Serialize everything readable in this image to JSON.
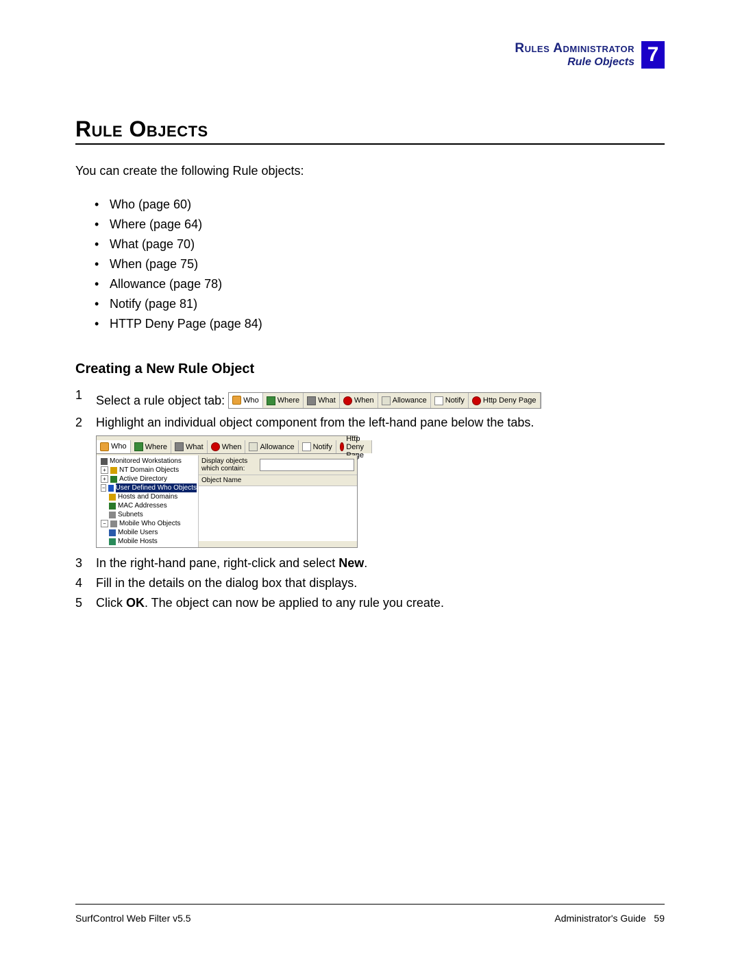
{
  "header": {
    "chapter": "Rules Administrator",
    "section": "Rule Objects",
    "num": "7"
  },
  "title": "Rule Objects",
  "intro": "You can create the following Rule objects:",
  "bullets": [
    "Who (page 60)",
    "Where (page 64)",
    "What (page 70)",
    "When (page 75)",
    "Allowance (page 78)",
    "Notify (page 81)",
    "HTTP Deny Page (page 84)"
  ],
  "subhead": "Creating a New Rule Object",
  "steps": {
    "s1": "Select a rule object tab:",
    "s2": "Highlight an individual object component from the left-hand pane below the tabs.",
    "s3a": "In the right-hand pane, right-click and select ",
    "s3b": "New",
    "s3c": ".",
    "s4": "Fill in the details on the dialog box that displays.",
    "s5a": "Click ",
    "s5b": "OK",
    "s5c": ". The object can now be applied to any rule you create."
  },
  "tabs": [
    "Who",
    "Where",
    "What",
    "When",
    "Allowance",
    "Notify",
    "Http Deny Page"
  ],
  "tree": {
    "n0": "Monitored Workstations",
    "n1": "NT Domain Objects",
    "n2": "Active Directory",
    "n3": "User Defined Who Objects",
    "n4": "Hosts and Domains",
    "n5": "MAC Addresses",
    "n6": "Subnets",
    "n7": "Mobile Who Objects",
    "n8": "Mobile Users",
    "n9": "Mobile Hosts"
  },
  "rpane": {
    "filter_label": "Display objects which contain:",
    "col": "Object Name"
  },
  "footer": {
    "left": "SurfControl Web Filter v5.5",
    "right_a": "Administrator's Guide",
    "right_b": "59"
  }
}
